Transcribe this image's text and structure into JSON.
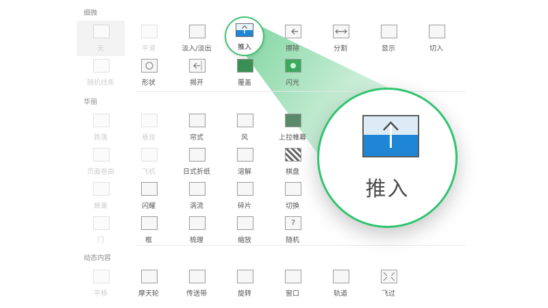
{
  "colors": {
    "accent": "#2fc46e",
    "push_blue": "#1f86d6"
  },
  "sections": {
    "subtle": "细微",
    "exciting": "华丽",
    "dynamic": "动态内容"
  },
  "tiles": {
    "row1": [
      "无",
      "平滑",
      "淡入/淡出",
      "推入",
      "擦除",
      "分割",
      "显示",
      "切入"
    ],
    "row2": [
      "随机线条",
      "形状",
      "揭开",
      "覆盖",
      "闪光"
    ],
    "row3": [
      "跌落",
      "悬挂",
      "帘式",
      "风",
      "上拉帷幕"
    ],
    "row4": [
      "页面卷曲",
      "飞机",
      "日式折纸",
      "溶解",
      "棋盘"
    ],
    "row5": [
      "蜂巢",
      "闪耀",
      "涡流",
      "碎片",
      "切换"
    ],
    "row6": [
      "门",
      "框",
      "梳理",
      "缩放",
      "随机"
    ],
    "row7": [
      "平移",
      "摩天轮",
      "传送带",
      "旋转",
      "窗口",
      "轨道",
      "飞过"
    ]
  },
  "magnifier": {
    "label": "推入",
    "icon": "push-icon"
  }
}
